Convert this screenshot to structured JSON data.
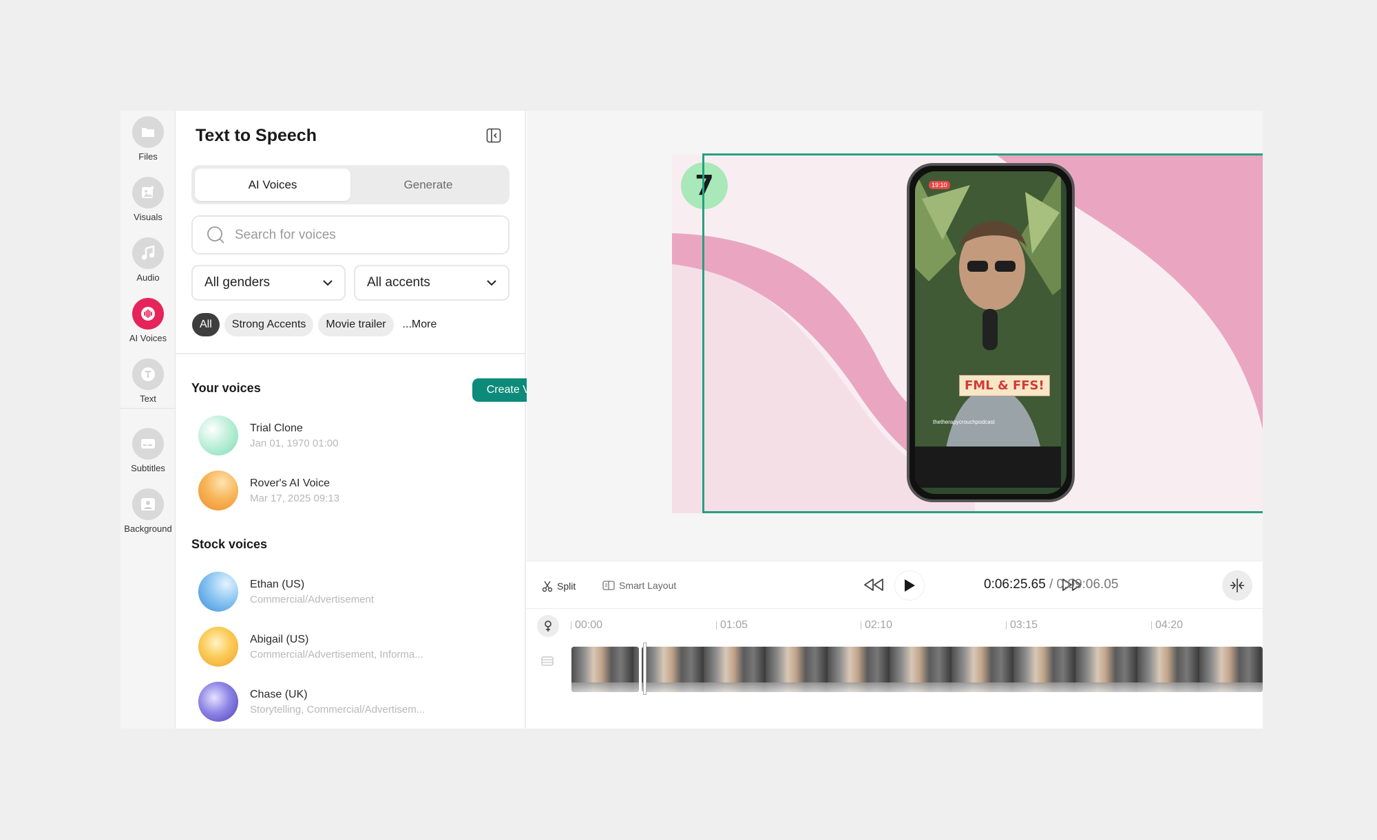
{
  "rail": {
    "items": [
      {
        "label": "Files",
        "icon": "folder-icon"
      },
      {
        "label": "Visuals",
        "icon": "image-plus-icon"
      },
      {
        "label": "Audio",
        "icon": "music-note-icon"
      },
      {
        "label": "AI Voices",
        "icon": "waveform-icon"
      },
      {
        "label": "Text",
        "icon": "text-icon"
      },
      {
        "label": "Subtitles",
        "icon": "subtitles-icon"
      },
      {
        "label": "Background",
        "icon": "background-image-icon"
      }
    ],
    "active": "AI Voices",
    "accent_color": "#e5245a"
  },
  "panel": {
    "title": "Text to Speech",
    "tabs": [
      {
        "label": "AI Voices",
        "active": true
      },
      {
        "label": "Generate",
        "active": false
      }
    ],
    "search": {
      "placeholder": "Search for voices",
      "value": ""
    },
    "filters": {
      "gender": "All genders",
      "accent": "All accents"
    },
    "chips": [
      {
        "label": "All",
        "active": true
      },
      {
        "label": "Strong Accents",
        "active": false
      },
      {
        "label": "Movie trailer",
        "active": false
      },
      {
        "label": "...More",
        "active": false
      }
    ],
    "your_voices": {
      "title": "Your voices",
      "create_label": "Create Voice",
      "items": [
        {
          "name": "Trial Clone",
          "sub": "Jan 01, 1970 01:00"
        },
        {
          "name": "Rover's AI Voice",
          "sub": "Mar 17, 2025 09:13"
        }
      ]
    },
    "stock_voices": {
      "title": "Stock voices",
      "items": [
        {
          "name": "Ethan (US)",
          "sub": "Commercial/Advertisement"
        },
        {
          "name": "Abigail (US)",
          "sub": "Commercial/Advertisement, Informa..."
        },
        {
          "name": "Chase (UK)",
          "sub": "Storytelling, Commercial/Advertisem..."
        }
      ]
    },
    "create_button_color": "#0c8a7a"
  },
  "preview": {
    "badge": "7",
    "caption": "FML & FFS!",
    "phone_time": "19:10",
    "phone_handle": "thetherapycrouchpodcast"
  },
  "controls": {
    "split_label": "Split",
    "smart_layout_label": "Smart Layout",
    "current_time": "0:06:25.65",
    "total_time": "/ 0:09:06.05"
  },
  "timeline": {
    "ticks": [
      "00:00",
      "01:05",
      "02:10",
      "03:15",
      "04:20"
    ]
  }
}
